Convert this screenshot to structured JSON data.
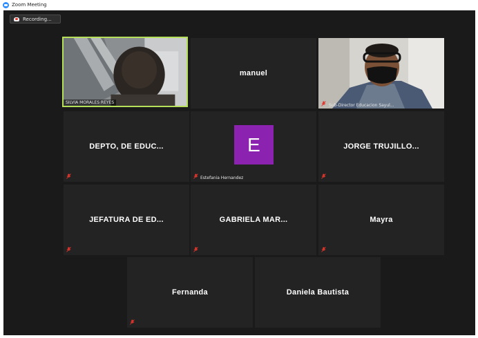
{
  "window": {
    "title": "Zoom Meeting"
  },
  "recording": {
    "label": "Recording..."
  },
  "tiles": [
    {
      "name": "",
      "caption": "SILVIA MORALES REYES"
    },
    {
      "name": "manuel"
    },
    {
      "name": "",
      "caption": "Sub-Director Educacion Sayul..."
    },
    {
      "name": "DEPTO, DE EDUC..."
    },
    {
      "name": "",
      "avatar_letter": "E",
      "caption": "Estefania Hernandez",
      "avatar_color": "#8b22b0"
    },
    {
      "name": "JORGE TRUJILLO..."
    },
    {
      "name": "JEFATURA DE ED..."
    },
    {
      "name": "GABRIELA MAR..."
    },
    {
      "name": "Mayra"
    },
    {
      "name": "Fernanda"
    },
    {
      "name": "Daniela Bautista"
    }
  ],
  "colors": {
    "active_speaker_border": "#b7e05a",
    "muted_mic": "#e0352b",
    "tile_bg": "#232323",
    "stage_bg": "#1a1a1a"
  }
}
